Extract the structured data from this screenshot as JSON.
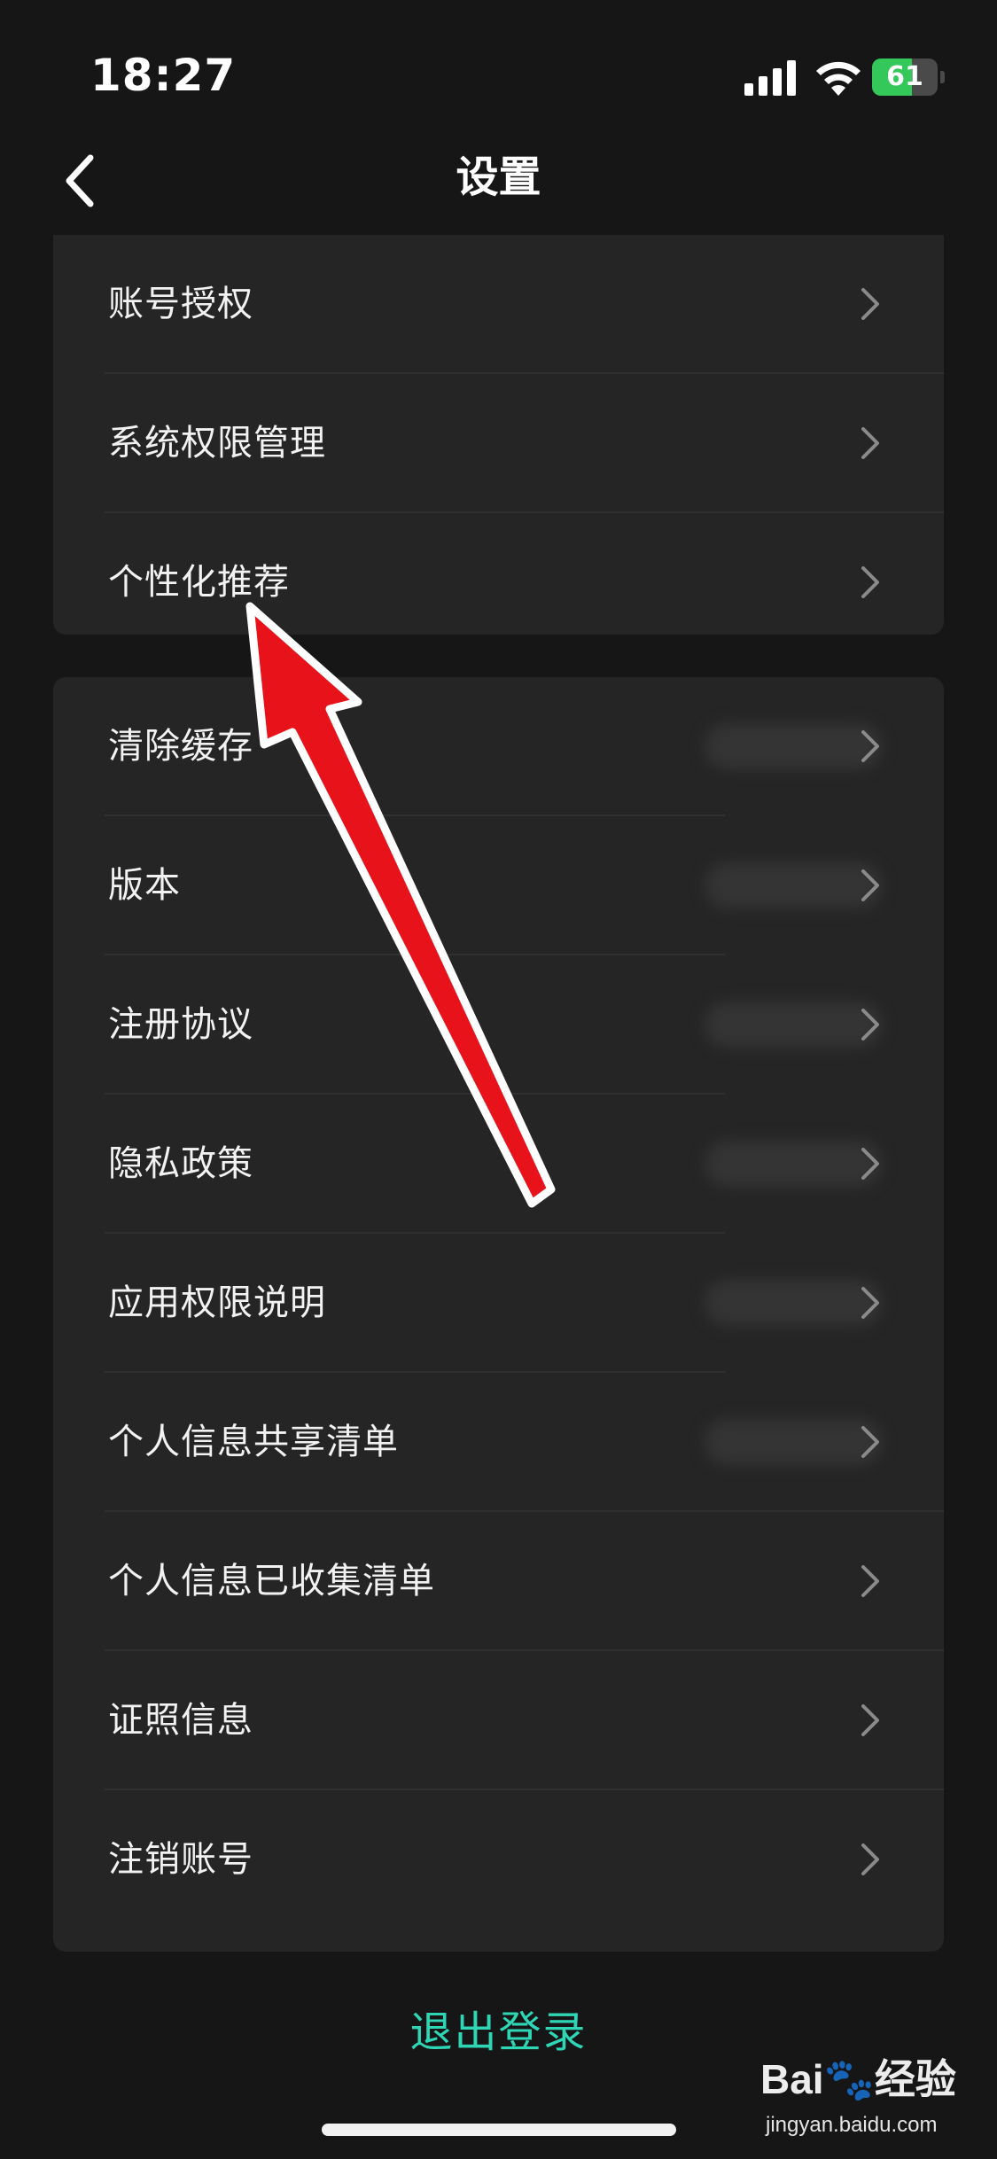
{
  "status_bar": {
    "time": "18:27",
    "battery": "61",
    "battery_level": 0.61,
    "battery_color": "#34c759"
  },
  "nav": {
    "back_icon": "chevron-left-icon",
    "title": "设置"
  },
  "section1": {
    "items": [
      {
        "label": "账号授权"
      },
      {
        "label": "系统权限管理"
      },
      {
        "label": "个性化推荐"
      }
    ]
  },
  "section2": {
    "items": [
      {
        "label": "清除缓存"
      },
      {
        "label": "版本"
      },
      {
        "label": "注册协议"
      },
      {
        "label": "隐私政策"
      },
      {
        "label": "应用权限说明"
      },
      {
        "label": "个人信息共享清单"
      },
      {
        "label": "个人信息已收集清单"
      },
      {
        "label": "证照信息"
      },
      {
        "label": "注销账号"
      }
    ]
  },
  "logout_label": "退出登录",
  "watermark": {
    "logo_a": "Bai",
    "logo_b": "经验",
    "url": "jingyan.baidu.com"
  },
  "colors": {
    "accent": "#2fd6b6",
    "annotation_arrow": "#e8121b"
  }
}
